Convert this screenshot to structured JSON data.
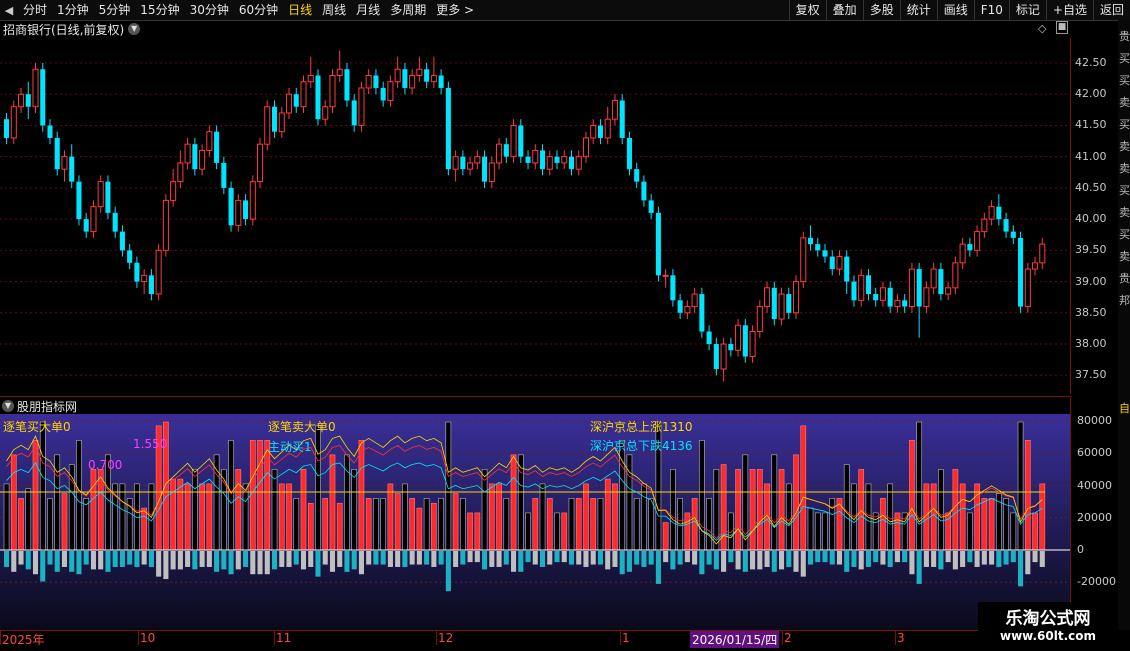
{
  "toolbar": {
    "left_items": [
      "分时",
      "1分钟",
      "5分钟",
      "15分钟",
      "30分钟",
      "60分钟",
      "日线",
      "周线",
      "月线",
      "多周期",
      "更多 >"
    ],
    "active": "日线",
    "right_items": [
      "复权",
      "叠加",
      "多股",
      "统计",
      "画线",
      "F10",
      "标记",
      "+自选",
      "返回"
    ]
  },
  "stock": {
    "title": "招商银行(日线,前复权)"
  },
  "price_axis": [
    "42.50",
    "42.00",
    "41.50",
    "41.00",
    "40.50",
    "40.00",
    "39.50",
    "39.00",
    "38.50",
    "38.00",
    "37.50"
  ],
  "indicator": {
    "title": "股朋指标网",
    "labels": {
      "buy_big": "逐笔买大单0",
      "sell_big": "逐笔卖大单0",
      "active_buy": "主动买1",
      "up_count": "深沪京总上涨1310",
      "down_count": "深沪京总下跌4136",
      "value_a": "0.700",
      "value_b": "1.550"
    },
    "axis": [
      "80000",
      "60000",
      "40000",
      "20000",
      "0",
      "-20000"
    ]
  },
  "date_axis": {
    "labels": [
      "2025年",
      "10",
      "11",
      "12",
      "1",
      "2",
      "3"
    ],
    "cursor": "2026/01/15/四"
  },
  "side_panel": {
    "chars": [
      "贵",
      "买",
      "买",
      "卖",
      "买",
      "卖",
      "卖",
      "买",
      "卖",
      "买",
      "卖",
      "贵",
      "邦"
    ],
    "ind_char": "自"
  },
  "watermark": {
    "main": "乐淘公式网",
    "sub": "www.60lt.com"
  },
  "colors": {
    "up": "#ff3b3b",
    "down": "#00e5ff",
    "grid": "#5a0e0e",
    "bg_ind_top": "#3a2f9a",
    "bg_ind_bottom": "#0a0a1a"
  },
  "chart_data": {
    "type": "candlestick",
    "price_range": [
      37.2,
      42.9
    ],
    "candles": [
      [
        41.6,
        41.3,
        41.7,
        41.2
      ],
      [
        41.3,
        41.8,
        41.9,
        41.2
      ],
      [
        41.8,
        42.0,
        42.1,
        41.7
      ],
      [
        42.0,
        41.8,
        42.2,
        41.6
      ],
      [
        41.8,
        42.4,
        42.5,
        41.7
      ],
      [
        42.4,
        41.5,
        42.5,
        41.4
      ],
      [
        41.5,
        41.3,
        41.6,
        41.2
      ],
      [
        41.3,
        40.8,
        41.4,
        40.7
      ],
      [
        40.8,
        41.0,
        41.1,
        40.6
      ],
      [
        41.0,
        40.6,
        41.2,
        40.5
      ],
      [
        40.6,
        40.0,
        40.7,
        39.9
      ],
      [
        40.0,
        39.8,
        40.1,
        39.7
      ],
      [
        39.8,
        40.2,
        40.3,
        39.7
      ],
      [
        40.2,
        40.6,
        40.7,
        40.1
      ],
      [
        40.6,
        40.1,
        40.7,
        40.0
      ],
      [
        40.1,
        39.8,
        40.2,
        39.7
      ],
      [
        39.8,
        39.5,
        39.9,
        39.4
      ],
      [
        39.5,
        39.3,
        39.6,
        39.2
      ],
      [
        39.3,
        39.0,
        39.4,
        38.9
      ],
      [
        39.0,
        39.1,
        39.2,
        38.8
      ],
      [
        39.1,
        38.8,
        39.2,
        38.7
      ],
      [
        38.8,
        39.5,
        39.6,
        38.7
      ],
      [
        39.5,
        40.3,
        40.4,
        39.4
      ],
      [
        40.3,
        40.6,
        40.8,
        40.2
      ],
      [
        40.6,
        40.9,
        41.1,
        40.5
      ],
      [
        40.9,
        41.2,
        41.3,
        40.8
      ],
      [
        41.2,
        40.8,
        41.3,
        40.7
      ],
      [
        40.8,
        41.1,
        41.2,
        40.7
      ],
      [
        41.1,
        41.4,
        41.5,
        41.0
      ],
      [
        41.4,
        40.9,
        41.5,
        40.8
      ],
      [
        40.9,
        40.5,
        41.0,
        40.4
      ],
      [
        40.5,
        39.9,
        40.6,
        39.8
      ],
      [
        39.9,
        40.3,
        40.4,
        39.8
      ],
      [
        40.3,
        40.0,
        40.4,
        39.9
      ],
      [
        40.0,
        40.6,
        40.7,
        39.9
      ],
      [
        40.6,
        41.2,
        41.3,
        40.5
      ],
      [
        41.2,
        41.8,
        41.9,
        41.1
      ],
      [
        41.8,
        41.4,
        41.9,
        41.3
      ],
      [
        41.4,
        41.7,
        41.8,
        41.3
      ],
      [
        41.7,
        42.0,
        42.1,
        41.6
      ],
      [
        42.0,
        41.8,
        42.1,
        41.7
      ],
      [
        41.8,
        42.2,
        42.3,
        41.7
      ],
      [
        42.2,
        42.3,
        42.6,
        42.1
      ],
      [
        42.3,
        41.6,
        42.4,
        41.5
      ],
      [
        41.6,
        41.8,
        41.9,
        41.5
      ],
      [
        41.8,
        42.3,
        42.4,
        41.7
      ],
      [
        42.3,
        42.4,
        42.7,
        42.2
      ],
      [
        42.4,
        41.9,
        42.5,
        41.8
      ],
      [
        41.9,
        41.5,
        42.0,
        41.4
      ],
      [
        41.5,
        42.1,
        42.2,
        41.4
      ],
      [
        42.1,
        42.3,
        42.4,
        42.0
      ],
      [
        42.3,
        42.1,
        42.4,
        42.0
      ],
      [
        42.1,
        41.9,
        42.2,
        41.8
      ],
      [
        41.9,
        42.2,
        42.3,
        41.8
      ],
      [
        42.2,
        42.4,
        42.6,
        42.1
      ],
      [
        42.4,
        42.1,
        42.5,
        42.0
      ],
      [
        42.1,
        42.3,
        42.4,
        42.0
      ],
      [
        42.3,
        42.4,
        42.6,
        42.2
      ],
      [
        42.4,
        42.2,
        42.5,
        42.1
      ],
      [
        42.2,
        42.3,
        42.6,
        42.1
      ],
      [
        42.3,
        42.1,
        42.4,
        42.0
      ],
      [
        42.1,
        40.8,
        42.2,
        40.7
      ],
      [
        40.8,
        41.0,
        41.1,
        40.6
      ],
      [
        41.0,
        40.8,
        41.1,
        40.7
      ],
      [
        40.8,
        40.9,
        41.0,
        40.7
      ],
      [
        40.9,
        41.0,
        41.1,
        40.8
      ],
      [
        41.0,
        40.6,
        41.1,
        40.5
      ],
      [
        40.6,
        40.9,
        41.0,
        40.5
      ],
      [
        40.9,
        41.2,
        41.3,
        40.8
      ],
      [
        41.2,
        41.0,
        41.3,
        40.9
      ],
      [
        41.0,
        41.5,
        41.6,
        40.9
      ],
      [
        41.5,
        41.0,
        41.6,
        40.9
      ],
      [
        41.0,
        40.9,
        41.1,
        40.8
      ],
      [
        40.9,
        41.1,
        41.2,
        40.8
      ],
      [
        41.1,
        40.8,
        41.2,
        40.7
      ],
      [
        40.8,
        41.0,
        41.1,
        40.7
      ],
      [
        41.0,
        40.9,
        41.1,
        40.8
      ],
      [
        40.9,
        41.0,
        41.1,
        40.8
      ],
      [
        41.0,
        40.8,
        41.1,
        40.7
      ],
      [
        40.8,
        41.0,
        41.1,
        40.7
      ],
      [
        41.0,
        41.3,
        41.4,
        40.9
      ],
      [
        41.3,
        41.5,
        41.6,
        41.2
      ],
      [
        41.5,
        41.3,
        41.6,
        41.2
      ],
      [
        41.3,
        41.6,
        41.8,
        41.2
      ],
      [
        41.6,
        41.9,
        42.0,
        41.5
      ],
      [
        41.9,
        41.3,
        42.0,
        41.2
      ],
      [
        41.3,
        40.8,
        41.4,
        40.7
      ],
      [
        40.8,
        40.6,
        40.9,
        40.5
      ],
      [
        40.6,
        40.3,
        40.7,
        40.2
      ],
      [
        40.3,
        40.1,
        40.4,
        40.0
      ],
      [
        40.1,
        39.1,
        40.2,
        39.0
      ],
      [
        39.1,
        39.1,
        39.2,
        38.9
      ],
      [
        39.1,
        38.7,
        39.2,
        38.6
      ],
      [
        38.7,
        38.5,
        38.8,
        38.4
      ],
      [
        38.5,
        38.6,
        38.7,
        38.4
      ],
      [
        38.6,
        38.8,
        38.9,
        38.5
      ],
      [
        38.8,
        38.2,
        38.9,
        38.1
      ],
      [
        38.2,
        38.0,
        38.3,
        37.9
      ],
      [
        38.0,
        37.6,
        38.1,
        37.5
      ],
      [
        37.6,
        38.0,
        38.1,
        37.4
      ],
      [
        38.0,
        37.9,
        38.1,
        37.8
      ],
      [
        37.9,
        38.3,
        38.4,
        37.8
      ],
      [
        38.3,
        37.8,
        38.4,
        37.7
      ],
      [
        37.8,
        38.2,
        38.3,
        37.7
      ],
      [
        38.2,
        38.6,
        38.7,
        38.1
      ],
      [
        38.6,
        38.9,
        39.0,
        38.5
      ],
      [
        38.9,
        38.4,
        39.0,
        38.3
      ],
      [
        38.4,
        38.8,
        38.9,
        38.3
      ],
      [
        38.8,
        38.5,
        38.9,
        38.4
      ],
      [
        38.5,
        39.0,
        39.1,
        38.4
      ],
      [
        39.0,
        39.7,
        39.8,
        38.9
      ],
      [
        39.7,
        39.6,
        39.9,
        39.5
      ],
      [
        39.6,
        39.5,
        39.7,
        39.4
      ],
      [
        39.5,
        39.4,
        39.6,
        39.3
      ],
      [
        39.4,
        39.2,
        39.5,
        39.1
      ],
      [
        39.2,
        39.4,
        39.5,
        39.1
      ],
      [
        39.4,
        39.0,
        39.5,
        38.8
      ],
      [
        39.0,
        38.7,
        39.1,
        38.6
      ],
      [
        38.7,
        39.1,
        39.2,
        38.6
      ],
      [
        39.1,
        38.8,
        39.2,
        38.7
      ],
      [
        38.8,
        38.7,
        38.9,
        38.6
      ],
      [
        38.7,
        38.9,
        39.0,
        38.6
      ],
      [
        38.9,
        38.6,
        39.0,
        38.5
      ],
      [
        38.6,
        38.7,
        38.8,
        38.5
      ],
      [
        38.7,
        38.6,
        38.8,
        38.5
      ],
      [
        38.6,
        39.2,
        39.3,
        38.5
      ],
      [
        39.2,
        38.6,
        39.3,
        38.1
      ],
      [
        38.6,
        38.9,
        39.0,
        38.5
      ],
      [
        38.9,
        39.2,
        39.3,
        38.8
      ],
      [
        39.2,
        38.8,
        39.3,
        38.7
      ],
      [
        38.8,
        38.9,
        39.0,
        38.7
      ],
      [
        38.9,
        39.3,
        39.4,
        38.8
      ],
      [
        39.3,
        39.6,
        39.7,
        39.2
      ],
      [
        39.6,
        39.5,
        39.7,
        39.4
      ],
      [
        39.5,
        39.8,
        39.9,
        39.4
      ],
      [
        39.8,
        40.0,
        40.1,
        39.7
      ],
      [
        40.0,
        40.2,
        40.3,
        39.9
      ],
      [
        40.2,
        40.0,
        40.4,
        39.9
      ],
      [
        40.0,
        39.8,
        40.1,
        39.7
      ],
      [
        39.8,
        39.7,
        39.9,
        39.6
      ],
      [
        39.7,
        38.6,
        39.8,
        38.5
      ],
      [
        38.6,
        39.2,
        39.3,
        38.5
      ],
      [
        39.2,
        39.3,
        39.4,
        39.1
      ],
      [
        39.3,
        39.6,
        39.7,
        39.2
      ]
    ]
  }
}
